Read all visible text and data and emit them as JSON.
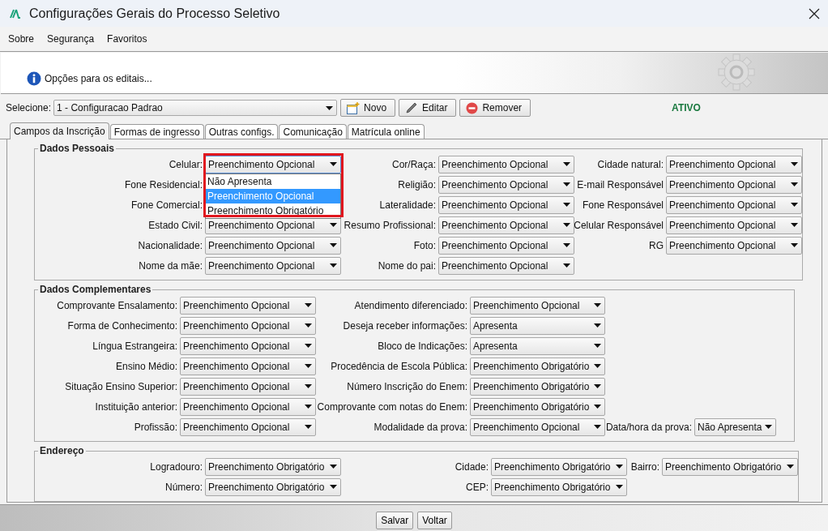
{
  "window": {
    "title": "Configurações Gerais do Processo Seletivo"
  },
  "menu": [
    {
      "label": "Sobre"
    },
    {
      "label": "Segurança"
    },
    {
      "label": "Favoritos"
    }
  ],
  "banner": {
    "text": "Opções para os editais..."
  },
  "selector": {
    "label": "Selecione:",
    "value": "1 - Configuracao Padrao",
    "status": "ATIVO"
  },
  "actions": [
    {
      "kind": "new",
      "label": "Novo"
    },
    {
      "kind": "edit",
      "label": "Editar"
    },
    {
      "kind": "remove",
      "label": "Remover"
    }
  ],
  "tabs": [
    {
      "label": "Campos da Inscrição",
      "selected": true
    },
    {
      "label": "Formas de ingresso",
      "selected": false
    },
    {
      "label": "Outras configs.",
      "selected": false
    },
    {
      "label": "Comunicação",
      "selected": false
    },
    {
      "label": "Matrícula online",
      "selected": false
    }
  ],
  "sections": [
    {
      "title": "Dados Pessoais",
      "rows": [
        [
          {
            "label": "Celular:",
            "value": "Preenchimento Opcional",
            "open": true,
            "highlighted": true,
            "options": [
              {
                "label": "Não Apresenta",
                "selected": false
              },
              {
                "label": "Preenchimento Opcional",
                "selected": true
              },
              {
                "label": "Preenchimento Obrigatório",
                "selected": false
              }
            ]
          },
          {
            "label": "Cor/Raça:",
            "value": "Preenchimento Opcional"
          },
          {
            "label": "Cidade natural:",
            "value": "Preenchimento Opcional"
          }
        ],
        [
          {
            "label": "Fone Residencial:"
          },
          {
            "label": "Religião:",
            "value": "Preenchimento Opcional"
          },
          {
            "label": "E-mail Responsável",
            "value": "Preenchimento Opcional"
          }
        ],
        [
          {
            "label": "Fone Comercial:"
          },
          {
            "label": "Lateralidade:",
            "value": "Preenchimento Opcional"
          },
          {
            "label": "Fone Responsável",
            "value": "Preenchimento Opcional"
          }
        ],
        [
          {
            "label": "Estado Civil:",
            "value": "Preenchimento Opcional"
          },
          {
            "label": "Resumo Profissional:",
            "value": "Preenchimento Opcional"
          },
          {
            "label": "Celular Responsável",
            "value": "Preenchimento Opcional"
          }
        ],
        [
          {
            "label": "Nacionalidade:",
            "value": "Preenchimento Opcional"
          },
          {
            "label": "Foto:",
            "value": "Preenchimento Opcional"
          },
          {
            "label": "RG",
            "value": "Preenchimento Opcional"
          }
        ],
        [
          {
            "label": "Nome da mãe:",
            "value": "Preenchimento Opcional"
          },
          {
            "label": "Nome do pai:",
            "value": "Preenchimento Opcional"
          }
        ]
      ]
    },
    {
      "title": "Dados Complementares",
      "rows": [
        [
          {
            "label": "Comprovante Ensalamento:",
            "value": "Preenchimento Opcional"
          },
          {
            "label": "Atendimento diferenciado:",
            "value": "Preenchimento Opcional"
          }
        ],
        [
          {
            "label": "Forma de Conhecimento:",
            "value": "Preenchimento Opcional"
          },
          {
            "label": "Deseja receber informações:",
            "value": "Apresenta"
          }
        ],
        [
          {
            "label": "Língua Estrangeira:",
            "value": "Preenchimento Opcional"
          },
          {
            "label": "Bloco de Indicações:",
            "value": "Apresenta"
          }
        ],
        [
          {
            "label": "Ensino Médio:",
            "value": "Preenchimento Opcional"
          },
          {
            "label": "Procedência de Escola Pública:",
            "value": "Preenchimento Obrigatório"
          }
        ],
        [
          {
            "label": "Situação Ensino Superior:",
            "value": "Preenchimento Opcional"
          },
          {
            "label": "Número Inscrição do Enem:",
            "value": "Preenchimento Obrigatório"
          }
        ],
        [
          {
            "label": "Instituição anterior:",
            "value": "Preenchimento Opcional"
          },
          {
            "label": "Comprovante com notas do Enem:",
            "value": "Preenchimento Obrigatório"
          }
        ],
        [
          {
            "label": "Profissão:",
            "value": "Preenchimento Opcional"
          },
          {
            "label": "Modalidade da prova:",
            "value": "Preenchimento Opcional"
          },
          {
            "label": "Data/hora da prova:",
            "value": "Não Apresenta"
          }
        ]
      ]
    },
    {
      "title": "Endereço",
      "rows": [
        [
          {
            "label": "Logradouro:",
            "value": "Preenchimento Obrigatório"
          },
          {
            "label": "Cidade:",
            "value": "Preenchimento Obrigatório"
          },
          {
            "label": "Bairro:",
            "value": "Preenchimento Obrigatório"
          }
        ],
        [
          {
            "label": "Número:",
            "value": "Preenchimento Obrigatório"
          },
          {
            "label": "CEP:",
            "value": "Preenchimento Obrigatório"
          }
        ]
      ]
    }
  ],
  "footer_buttons": [
    "Salvar",
    "Voltar"
  ]
}
